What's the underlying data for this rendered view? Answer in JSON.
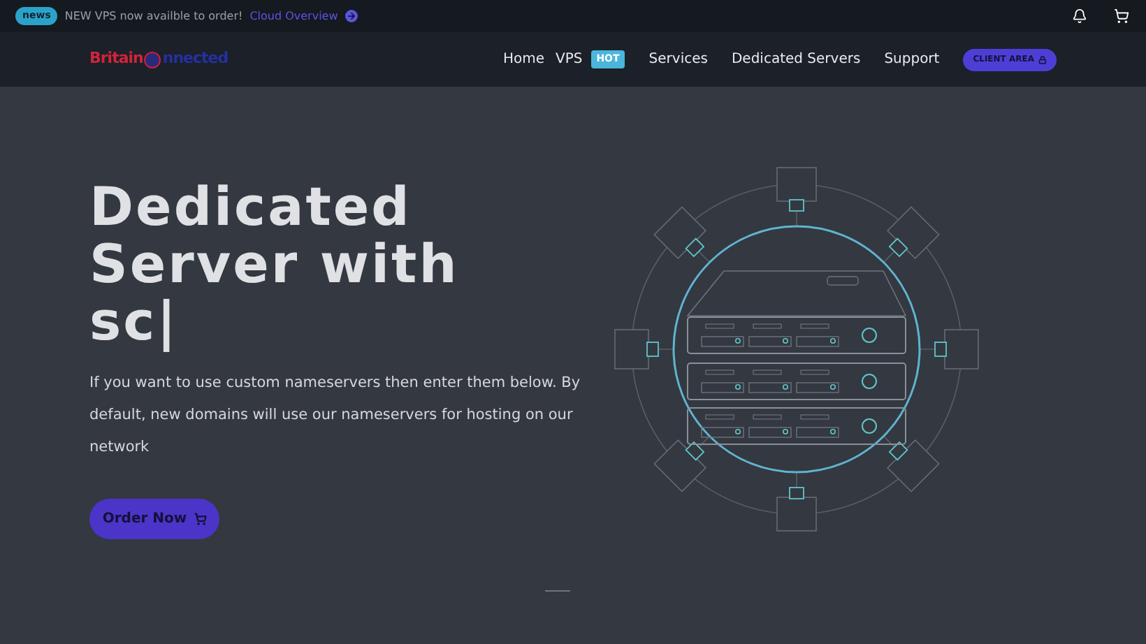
{
  "announcement": {
    "badge": "news",
    "text": "NEW VPS now availble to order!",
    "link": "Cloud Overview"
  },
  "logo": {
    "part_1": "Britain",
    "part_2": "nnected"
  },
  "nav": {
    "items": [
      {
        "label": "Home"
      },
      {
        "label": "VPS",
        "badge": "HOT"
      },
      {
        "label": "Services"
      },
      {
        "label": "Dedicated Servers"
      },
      {
        "label": "Support"
      }
    ],
    "client_button": "CLIENT AREA"
  },
  "hero": {
    "headline_lines": [
      "Dedicated",
      "Server with",
      "sc|"
    ],
    "description": "If you want to use custom nameservers then enter them below. By default, new domains will use our nameservers for hosting on our network",
    "cta": "Order Now"
  }
}
